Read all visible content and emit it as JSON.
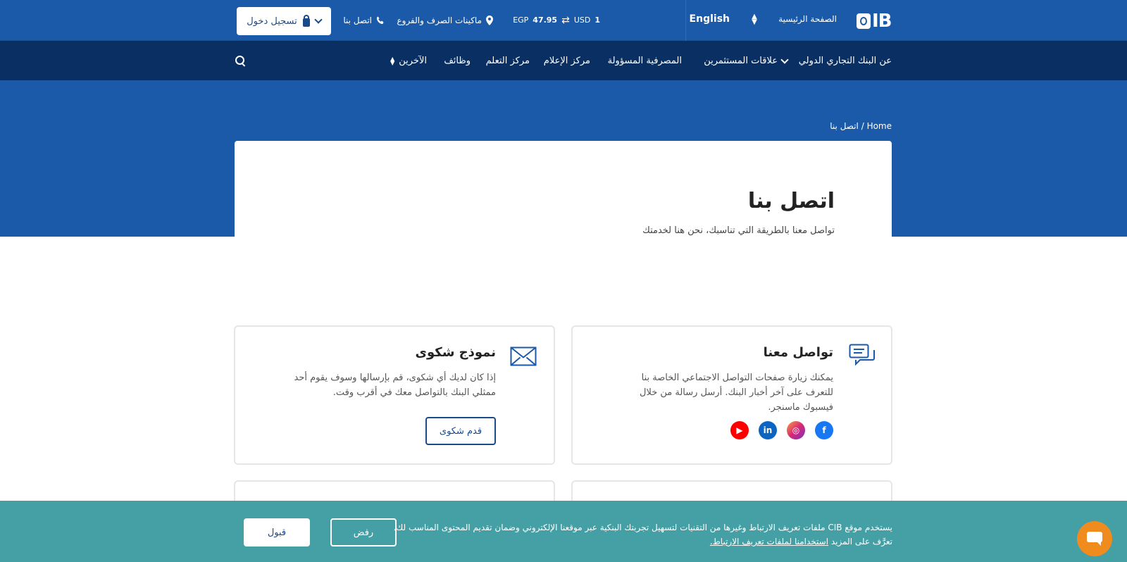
{
  "topbar": {
    "logo_text": "IB",
    "home_label": "الصفحة الرئيسية",
    "language_label": "English",
    "fx": {
      "from_amount": "1",
      "from_currency": "USD",
      "to_amount": "47.95",
      "to_currency": "EGP"
    },
    "atm_label": "ماكينات الصرف والفروع",
    "contact_label": "اتصل بنا",
    "login_label": "تسجيل دخول"
  },
  "nav": {
    "items": [
      "عن البنك التجاري الدولي",
      "علاقات المستثمرين",
      "المصرفية المسؤولة",
      "مركز الإعلام",
      "مركز التعلم",
      "وظائف",
      "الآخرين"
    ]
  },
  "breadcrumb": {
    "home": "Home",
    "current": "اتصل بنا"
  },
  "hero": {
    "title": "اتصل بنا",
    "subtitle": "تواصل معنا بالطريقة التي تناسبك، نحن هنا لخدمتك"
  },
  "cards": {
    "social": {
      "title": "تواصل معنا",
      "text": "يمكنك زيارة صفحات التواصل الاجتماعي الخاصة بنا للتعرف على آخر أخبار البنك. أرسل رسالة من خلال فيسبوك ماسنجر.",
      "icons": [
        "facebook-icon",
        "instagram-icon",
        "linkedin-icon",
        "youtube-icon"
      ]
    },
    "complaint": {
      "title": "نموذج شكوى",
      "text": "إذا كان لديك أي شكوى، قم بإرسالها وسوف يقوم أحد ممثلي البنك بالتواصل معك في أقرب وقت.",
      "button": "قدم شكوى"
    }
  },
  "cookie": {
    "text_before_link": "يستخدم موقع CIB ملفات تعريف الارتباط وغيرها من التقنيات لتسهيل تجربتك البنكية عبر موقعنا الإلكتروني وضمان تقديم المحتوى المناسب لك. تعرَّف على المزيد ",
    "link": "استخدامنا لملفات تعريف الارتباط.",
    "reject_label": "رفض",
    "accept_label": "قبول"
  },
  "colors": {
    "primary": "#1a5aa9",
    "nav": "#0a2f63",
    "cookie": "#45a0a6",
    "chat": "#f08c1e"
  }
}
